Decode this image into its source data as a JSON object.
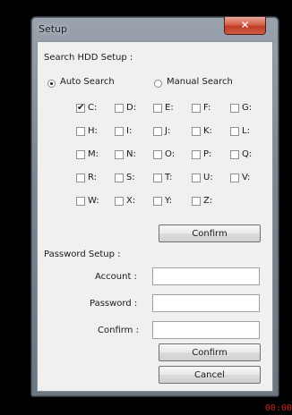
{
  "window": {
    "title": "Setup",
    "close_symbol": "✕"
  },
  "search": {
    "heading": "Search HDD Setup :",
    "modes": [
      {
        "label": "Auto Search",
        "selected": true
      },
      {
        "label": "Manual Search",
        "selected": false
      }
    ],
    "drives": [
      {
        "label": "C:",
        "checked": true
      },
      {
        "label": "D:",
        "checked": false
      },
      {
        "label": "E:",
        "checked": false
      },
      {
        "label": "F:",
        "checked": false
      },
      {
        "label": "G:",
        "checked": false
      },
      {
        "label": "H:",
        "checked": false
      },
      {
        "label": "I:",
        "checked": false
      },
      {
        "label": "J:",
        "checked": false
      },
      {
        "label": "K:",
        "checked": false
      },
      {
        "label": "L:",
        "checked": false
      },
      {
        "label": "M:",
        "checked": false
      },
      {
        "label": "N:",
        "checked": false
      },
      {
        "label": "O:",
        "checked": false
      },
      {
        "label": "P:",
        "checked": false
      },
      {
        "label": "Q:",
        "checked": false
      },
      {
        "label": "R:",
        "checked": false
      },
      {
        "label": "S:",
        "checked": false
      },
      {
        "label": "T:",
        "checked": false
      },
      {
        "label": "U:",
        "checked": false
      },
      {
        "label": "V:",
        "checked": false
      },
      {
        "label": "W:",
        "checked": false
      },
      {
        "label": "X:",
        "checked": false
      },
      {
        "label": "Y:",
        "checked": false
      },
      {
        "label": "Z:",
        "checked": false
      }
    ],
    "confirm_label": "Confirm"
  },
  "password": {
    "heading": "Password Setup :",
    "account_label": "Account :",
    "account_value": "",
    "password_label": "Password :",
    "password_value": "",
    "confirm_field_label": "Confirm :",
    "confirm_value": "",
    "confirm_button": "Confirm",
    "cancel_button": "Cancel"
  },
  "overlay_text": "00:00",
  "colors": {
    "titlebar": "#7d8792",
    "close_button": "#c94a35",
    "dialog_body": "#f0f0f0",
    "overlay_text": "#c8261d"
  }
}
